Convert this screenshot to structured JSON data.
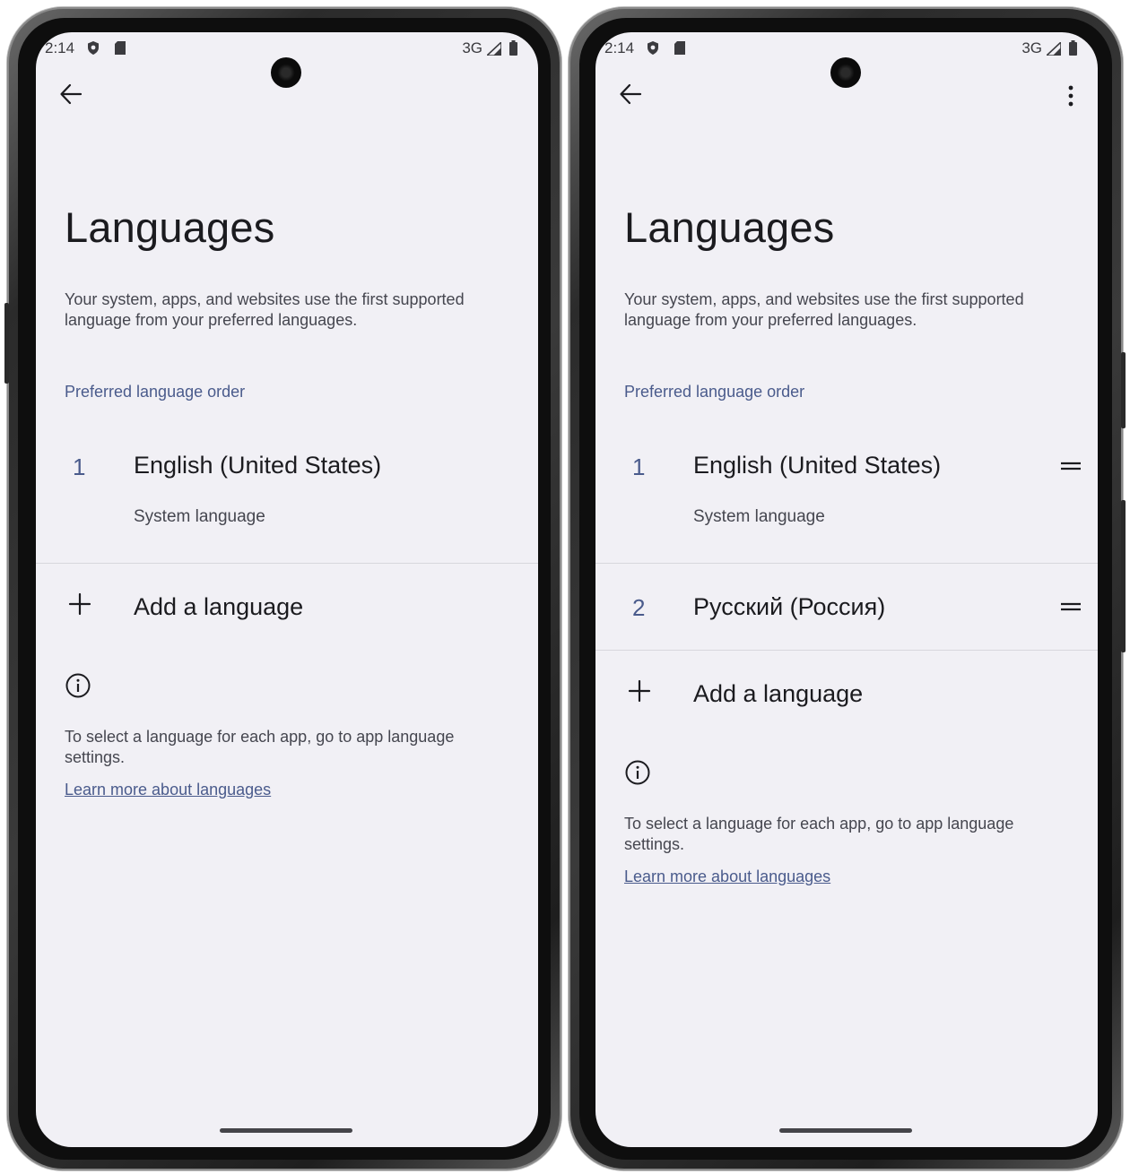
{
  "screens": [
    {
      "status": {
        "time": "2:14",
        "network": "3G"
      },
      "page_title": "Languages",
      "description": "Your system, apps, and websites use the first supported language from your preferred languages.",
      "section_header": "Preferred language order",
      "languages": [
        {
          "number": "1",
          "name": "English (United States)",
          "subtitle": "System language"
        }
      ],
      "add_language_label": "Add a language",
      "footer_text": "To select a language for each app, go to app language settings.",
      "learn_more_link": "Learn more about languages",
      "icons": {
        "back": "arrow-left-icon",
        "add": "plus-icon",
        "info": "info-icon"
      }
    },
    {
      "status": {
        "time": "2:14",
        "network": "3G"
      },
      "page_title": "Languages",
      "description": "Your system, apps, and websites use the first supported language from your preferred languages.",
      "section_header": "Preferred language order",
      "languages": [
        {
          "number": "1",
          "name": "English (United States)",
          "subtitle": "System language"
        },
        {
          "number": "2",
          "name": "Русский (Россия)",
          "subtitle": ""
        }
      ],
      "add_language_label": "Add a language",
      "footer_text": "To select a language for each app, go to app language settings.",
      "learn_more_link": "Learn more about languages",
      "icons": {
        "back": "arrow-left-icon",
        "more": "more-vert-icon",
        "drag": "drag-handle-icon",
        "add": "plus-icon",
        "info": "info-icon"
      }
    }
  ],
  "colors": {
    "screen_bg": "#f1f0f5",
    "accent": "#4a5b8c",
    "text_primary": "#1b1b1f",
    "text_secondary": "#45464f"
  }
}
